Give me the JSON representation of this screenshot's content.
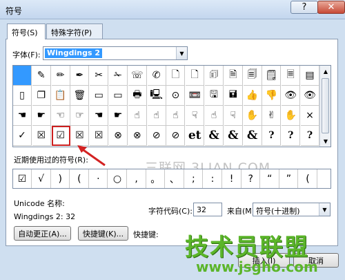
{
  "window": {
    "title": "符号"
  },
  "tabs": [
    {
      "label": "符号(S)"
    },
    {
      "label": "特殊字符(P)"
    }
  ],
  "font": {
    "label": "字体(F):",
    "value": "Wingdings 2"
  },
  "symbol_grid": {
    "rows": [
      [
        "",
        "✎",
        "✏",
        "✒",
        "✂",
        "✁",
        "☏",
        "✆",
        "🗋",
        "🗋",
        "🗊",
        "🗎",
        "🗐",
        "🗒",
        "🗏",
        "▤"
      ],
      [
        "▯",
        "❐",
        "📋",
        "🗑",
        "▭",
        "▭",
        "🖶",
        "🖳",
        "⊙",
        "📼",
        "🖫",
        "🖬",
        "👍",
        "👎",
        "👁",
        "👁"
      ],
      [
        "☚",
        "☛",
        "☜",
        "☞",
        "☚",
        "☛",
        "☝",
        "☝",
        "☝",
        "☟",
        "☝",
        "☟",
        "✋",
        "✌",
        "✋",
        "×"
      ],
      [
        "✓",
        "☒",
        "☑",
        "☒",
        "☒",
        "⊗",
        "⊗",
        "⊘",
        "⊘",
        "et",
        "&",
        "&",
        "&",
        "?",
        "?",
        "?"
      ]
    ]
  },
  "recent": {
    "label": "近期使用过的符号(R):",
    "symbols": [
      "☑",
      "√",
      ")",
      "(",
      "·",
      "○",
      ",",
      "。",
      "、",
      ";",
      ":",
      "!",
      "?",
      "“",
      "”",
      "("
    ]
  },
  "watermark": "三联网 3LIAN.COM",
  "unicode_name_label": "Unicode 名称:",
  "unicode_name_value": "Wingdings 2: 32",
  "char_code": {
    "label": "字符代码(C):",
    "value": "32"
  },
  "from": {
    "label": "来自(M):",
    "value": "符号(十进制)"
  },
  "buttons": {
    "autocorrect": "自动更正(A)...",
    "shortcut": "快捷键(K)...",
    "shortcut_key_label": "快捷键:",
    "insert": "插入(I)",
    "cancel": "取消"
  },
  "brand": {
    "main": "技术员联盟",
    "url": "www.jsgho.com"
  }
}
